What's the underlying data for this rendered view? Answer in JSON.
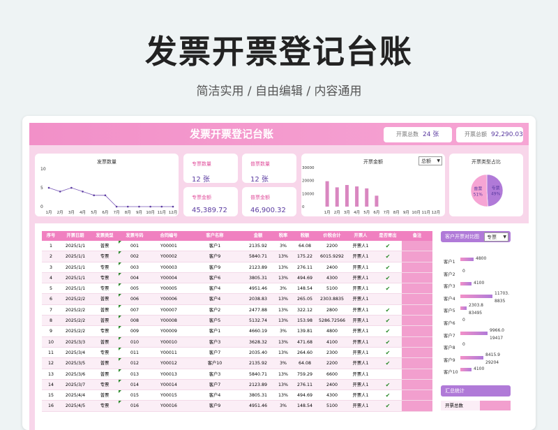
{
  "header": {
    "title": "发票开票登记台账",
    "subtitle": "简洁实用 / 自由编辑 / 内容通用"
  },
  "sheet": {
    "title": "发票开票登记台账",
    "total_count_label": "开票总数",
    "total_count": "24 张",
    "total_amount_label": "开票总额",
    "total_amount": "92,290.03"
  },
  "kpis": [
    {
      "title": "专票数量",
      "value": "12 张"
    },
    {
      "title": "普票数量",
      "value": "12 张"
    },
    {
      "title": "专票金额",
      "value": "45,389.72"
    },
    {
      "title": "普票金额",
      "value": "46,900.32"
    }
  ],
  "count_chart": {
    "title": "发票数量",
    "months": [
      "1月",
      "2月",
      "3月",
      "4月",
      "5月",
      "6月",
      "7月",
      "8月",
      "9月",
      "10月",
      "11月",
      "12月"
    ],
    "yticks": [
      "10",
      "5",
      "0"
    ],
    "values": [
      5,
      4,
      5,
      4,
      3,
      3,
      0,
      0,
      0,
      0,
      0,
      0
    ]
  },
  "amount_chart": {
    "title": "开票金额",
    "selector": "总额",
    "months": [
      "1月",
      "2月",
      "3月",
      "4月",
      "5月",
      "6月",
      "7月",
      "8月",
      "9月",
      "10月",
      "11月",
      "12月"
    ],
    "yticks": [
      "30000",
      "20000",
      "10000",
      "0"
    ],
    "values": [
      19500,
      14800,
      16600,
      15500,
      14000,
      8400,
      0,
      0,
      0,
      0,
      0,
      0
    ]
  },
  "pie_chart": {
    "title": "开票类型占比",
    "slices": [
      {
        "name": "专票",
        "pct": "49%",
        "value": 49,
        "color": "#b07ad8"
      },
      {
        "name": "普票",
        "pct": "51%",
        "value": 51,
        "color": "#f6a5d4"
      }
    ]
  },
  "table": {
    "columns": [
      "序号",
      "开票日期",
      "发票类型",
      "发票号码",
      "合同编号",
      "客户名称",
      "金额",
      "税率",
      "税额",
      "价税合计",
      "开票人",
      "是否寄出",
      "备注"
    ],
    "rows": [
      [
        "1",
        "2025/1/1",
        "普票",
        "001",
        "Y00001",
        "客户1",
        "2135.92",
        "3%",
        "64.08",
        "2200",
        "开票人1",
        "✔",
        ""
      ],
      [
        "2",
        "2025/1/1",
        "专票",
        "002",
        "Y00002",
        "客户9",
        "5840.71",
        "13%",
        "175.22",
        "6015.9292",
        "开票人1",
        "✔",
        ""
      ],
      [
        "3",
        "2025/1/1",
        "专票",
        "003",
        "Y00003",
        "客户9",
        "2123.89",
        "13%",
        "276.11",
        "2400",
        "开票人1",
        "✔",
        ""
      ],
      [
        "4",
        "2025/1/1",
        "专票",
        "004",
        "Y00004",
        "客户6",
        "3805.31",
        "13%",
        "494.69",
        "4300",
        "开票人1",
        "✔",
        ""
      ],
      [
        "5",
        "2025/1/1",
        "专票",
        "005",
        "Y00005",
        "客户4",
        "4951.46",
        "3%",
        "148.54",
        "5100",
        "开票人1",
        "✔",
        ""
      ],
      [
        "6",
        "2025/2/2",
        "普票",
        "006",
        "Y00006",
        "客户4",
        "2038.83",
        "13%",
        "265.05",
        "2303.8835",
        "开票人1",
        "",
        ""
      ],
      [
        "7",
        "2025/2/2",
        "普票",
        "007",
        "Y00007",
        "客户2",
        "2477.88",
        "13%",
        "322.12",
        "2800",
        "开票人1",
        "✔",
        ""
      ],
      [
        "8",
        "2025/2/2",
        "普票",
        "008",
        "Y00008",
        "客户5",
        "5132.74",
        "13%",
        "153.98",
        "5286.72566",
        "开票人1",
        "✔",
        ""
      ],
      [
        "9",
        "2025/2/2",
        "专票",
        "009",
        "Y00009",
        "客户1",
        "4660.19",
        "3%",
        "139.81",
        "4800",
        "开票人1",
        "✔",
        ""
      ],
      [
        "10",
        "2025/3/3",
        "普票",
        "010",
        "Y00010",
        "客户3",
        "3628.32",
        "13%",
        "471.68",
        "4100",
        "开票人1",
        "✔",
        ""
      ],
      [
        "11",
        "2025/3/4",
        "专票",
        "011",
        "Y00011",
        "客户7",
        "2035.40",
        "13%",
        "264.60",
        "2300",
        "开票人1",
        "✔",
        ""
      ],
      [
        "12",
        "2025/3/5",
        "普票",
        "012",
        "Y00012",
        "客户10",
        "2135.92",
        "3%",
        "64.08",
        "2200",
        "开票人1",
        "✔",
        ""
      ],
      [
        "13",
        "2025/3/6",
        "普票",
        "013",
        "Y00013",
        "客户3",
        "5840.71",
        "13%",
        "759.29",
        "6600",
        "开票人1",
        "",
        ""
      ],
      [
        "14",
        "2025/3/7",
        "专票",
        "014",
        "Y00014",
        "客户7",
        "2123.89",
        "13%",
        "276.11",
        "2400",
        "开票人1",
        "✔",
        ""
      ],
      [
        "15",
        "2025/4/4",
        "普票",
        "015",
        "Y00015",
        "客户4",
        "3805.31",
        "13%",
        "494.69",
        "4300",
        "开票人1",
        "✔",
        ""
      ],
      [
        "16",
        "2025/4/5",
        "专票",
        "016",
        "Y00016",
        "客户9",
        "4951.46",
        "3%",
        "148.54",
        "5100",
        "开票人1",
        "✔",
        ""
      ]
    ]
  },
  "customer_compare": {
    "title": "客户开票对比图",
    "selector": "专票",
    "items": [
      {
        "name": "客户1",
        "v1": "4800",
        "v2": "",
        "w1": 0.27,
        "w2": 0
      },
      {
        "name": "客户2",
        "v1": "0",
        "v2": "",
        "w1": 0,
        "w2": 0
      },
      {
        "name": "客户3",
        "v1": "4100",
        "v2": "",
        "w1": 0.23,
        "w2": 0
      },
      {
        "name": "客户4",
        "v1": "11703.",
        "v2": "8835",
        "w1": 0.66,
        "w2": 0
      },
      {
        "name": "客户5",
        "v1": "2303.8",
        "v2": "83495",
        "w1": 0.13,
        "w2": 0
      },
      {
        "name": "客户6",
        "v1": "0",
        "v2": "",
        "w1": 0,
        "w2": 0
      },
      {
        "name": "客户7",
        "v1": "9966.0",
        "v2": "19417",
        "w1": 0.56,
        "w2": 0
      },
      {
        "name": "客户8",
        "v1": "0",
        "v2": "",
        "w1": 0,
        "w2": 0
      },
      {
        "name": "客户9",
        "v1": "8415.9",
        "v2": "29204",
        "w1": 0.47,
        "w2": 0
      },
      {
        "name": "客户10",
        "v1": "4100",
        "v2": "",
        "w1": 0.23,
        "w2": 0
      }
    ]
  },
  "summary": {
    "title": "汇总统计",
    "row_label": "开票总数"
  }
}
